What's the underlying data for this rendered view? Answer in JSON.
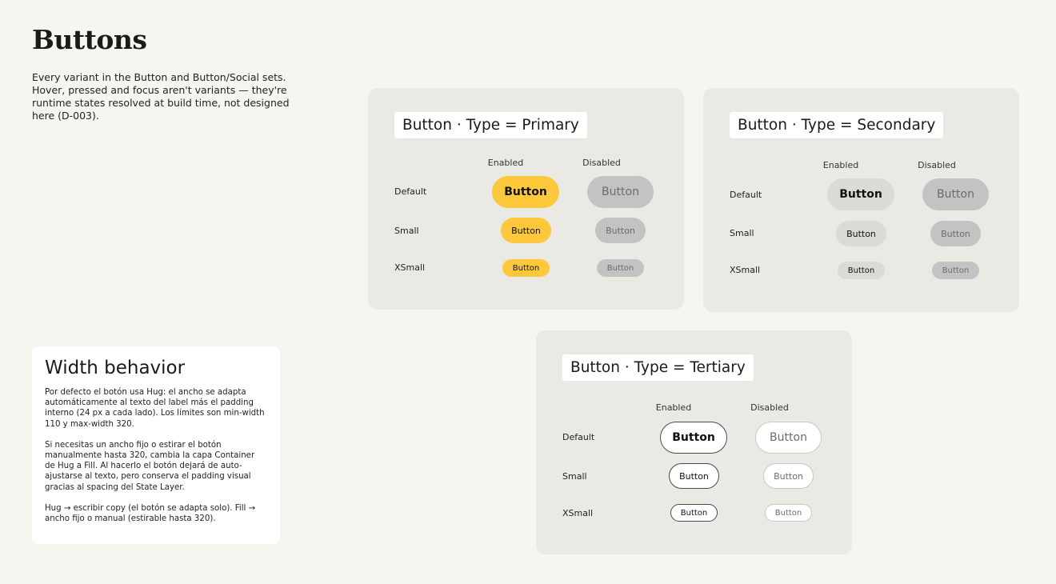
{
  "page": {
    "title": "Buttons",
    "description": "Every variant in the Button and Button/Social sets. Hover, pressed and focus aren't variants — they're runtime states resolved at build time, not designed here (D-003)."
  },
  "width_note": {
    "title": "Width behavior",
    "paragraphs": [
      "Por defecto el botón usa Hug: el ancho se adapta automáticamente al texto del label más el padding interno (24 px a cada lado). Los límites son min-width 110 y max-width 320.",
      "Si necesitas un ancho fijo o estirar el botón manualmente hasta 320, cambia la capa Container de Hug a Fill. Al hacerlo el botón dejará de auto-ajustarse al texto, pero conserva el padding visual gracias al spacing del State Layer.",
      "Hug → escribir copy (el botón se adapta solo). Fill → ancho fijo o manual (estirable hasta 320)."
    ]
  },
  "panels": {
    "primary": {
      "title": "Button · Type = Primary",
      "col_enabled": "Enabled",
      "col_disabled": "Disabled",
      "row_default": "Default",
      "row_small": "Small",
      "row_xsmall": "XSmall",
      "button_label": "Button"
    },
    "secondary": {
      "title": "Button · Type = Secondary",
      "col_enabled": "Enabled",
      "col_disabled": "Disabled",
      "row_default": "Default",
      "row_small": "Small",
      "row_xsmall": "XSmall",
      "button_label": "Button"
    },
    "tertiary": {
      "title": "Button · Type = Tertiary",
      "col_enabled": "Enabled",
      "col_disabled": "Disabled",
      "row_default": "Default",
      "row_small": "Small",
      "row_xsmall": "XSmall",
      "button_label": "Button"
    }
  },
  "colors": {
    "background": "#f6f5f0",
    "panel": "#ebe9e3",
    "primary_enabled": "#fdc83c",
    "secondary_enabled": "#dcdad5",
    "disabled_fill": "#c3c3c3",
    "tertiary_border": "#4a4a4a"
  }
}
